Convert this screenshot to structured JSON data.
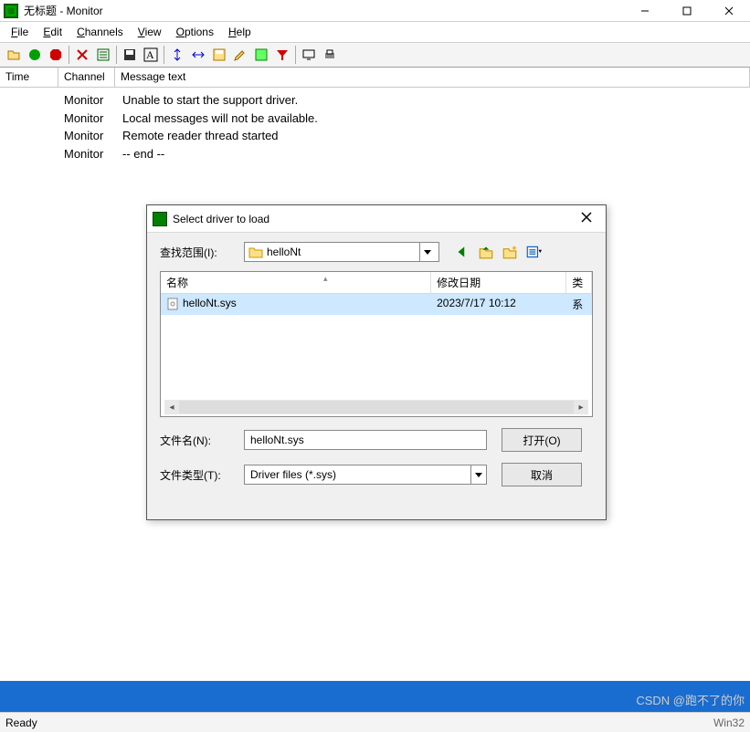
{
  "window": {
    "title": "无标题 - Monitor"
  },
  "menu": {
    "file": "File",
    "edit": "Edit",
    "channels": "Channels",
    "view": "View",
    "options": "Options",
    "help": "Help"
  },
  "columns": {
    "time": "Time",
    "channel": "Channel",
    "message": "Message text"
  },
  "messages": [
    {
      "time": "",
      "channel": "Monitor",
      "text": "Unable to start the support driver."
    },
    {
      "time": "",
      "channel": "Monitor",
      "text": "Local messages will not be available."
    },
    {
      "time": "",
      "channel": "Monitor",
      "text": "Remote reader thread started"
    },
    {
      "time": "",
      "channel": "Monitor",
      "text": "-- end --"
    }
  ],
  "dialog": {
    "title": "Select driver to load",
    "look_in_label": "查找范围(I):",
    "look_in_value": "helloNt",
    "col_name": "名称",
    "col_date": "修改日期",
    "col_type": "类",
    "files": [
      {
        "name": "helloNt.sys",
        "date": "2023/7/17 10:12",
        "type": "系"
      }
    ],
    "filename_label": "文件名(N):",
    "filename_value": "helloNt.sys",
    "filetype_label": "文件类型(T):",
    "filetype_value": "Driver files (*.sys)",
    "open_btn": "打开(O)",
    "cancel_btn": "取消"
  },
  "status": {
    "left": "Ready",
    "right": "Win32"
  },
  "watermark": "CSDN @跑不了的你"
}
